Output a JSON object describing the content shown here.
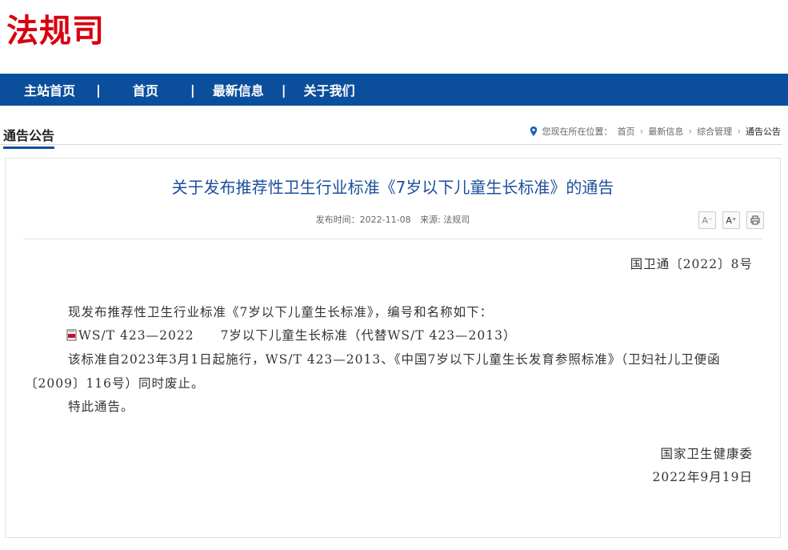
{
  "header": {
    "logo": "法规司"
  },
  "nav": {
    "items": [
      "主站首页",
      "首页",
      "最新信息",
      "关于我们"
    ],
    "separator": "|"
  },
  "section": {
    "title": "通告公告",
    "breadcrumb": {
      "prefix": "您现在所在位置：",
      "items": [
        "首页",
        "最新信息",
        "综合管理",
        "通告公告"
      ]
    }
  },
  "article": {
    "title": "关于发布推荐性卫生行业标准《7岁以下儿童生长标准》的通告",
    "meta": {
      "date": "发布时间：2022-11-08",
      "source": "来源: 法规司"
    },
    "tools": {
      "font_down": "A⁻",
      "font_up": "A⁺",
      "print_icon": "printer-icon"
    },
    "doc_number": "国卫通〔2022〕8号",
    "para1": "现发布推荐性卫生行业标准《7岁以下儿童生长标准》，编号和名称如下：",
    "standard_link": "WS/T 423—2022　　7岁以下儿童生长标准（代替WS/T 423—2013）",
    "para3": "该标准自2023年3月1日起施行，WS/T 423—2013、《中国7岁以下儿童生长发育参照标准》（卫妇社儿卫便函〔2009〕116号）同时废止。",
    "para4": "特此通告。",
    "signature": "国家卫生健康委",
    "sign_date": "2022年9月19日"
  },
  "colors": {
    "brand_red": "#d7000f",
    "nav_blue": "#0b4f9c",
    "title_blue": "#1c4f9c"
  }
}
